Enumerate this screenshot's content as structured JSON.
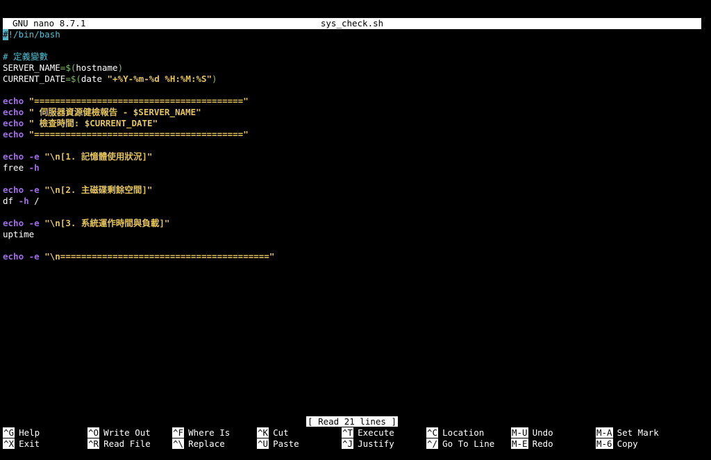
{
  "titlebar": {
    "app_version": "GNU nano 8.7.1",
    "filename": "sys_check.sh"
  },
  "lines": [
    [
      {
        "t": "#",
        "c": "cursor"
      },
      {
        "t": "!/bin/bash",
        "c": "cyan"
      }
    ],
    [],
    [
      {
        "t": "# 定義變數",
        "c": "cyan"
      }
    ],
    [
      {
        "t": "SERVER_NAME",
        "c": "white"
      },
      {
        "t": "=$(",
        "c": "green"
      },
      {
        "t": "hostname",
        "c": "white"
      },
      {
        "t": ")",
        "c": "green"
      }
    ],
    [
      {
        "t": "CURRENT_DATE",
        "c": "white"
      },
      {
        "t": "=$(",
        "c": "green"
      },
      {
        "t": "date ",
        "c": "white"
      },
      {
        "t": "\"+%Y-%m-%d %H:%M:%S\"",
        "c": "yellow"
      },
      {
        "t": ")",
        "c": "green"
      }
    ],
    [],
    [
      {
        "t": "echo ",
        "c": "purple"
      },
      {
        "t": "\"========================================\"",
        "c": "yellow"
      }
    ],
    [
      {
        "t": "echo ",
        "c": "purple"
      },
      {
        "t": "\" 伺服器資源健檢報告 - $SERVER_NAME\"",
        "c": "yellow"
      }
    ],
    [
      {
        "t": "echo ",
        "c": "purple"
      },
      {
        "t": "\" 檢查時間: $CURRENT_DATE\"",
        "c": "yellow"
      }
    ],
    [
      {
        "t": "echo ",
        "c": "purple"
      },
      {
        "t": "\"========================================\"",
        "c": "yellow"
      }
    ],
    [],
    [
      {
        "t": "echo ",
        "c": "purple"
      },
      {
        "t": "-e ",
        "c": "purple"
      },
      {
        "t": "\"\\n[1. 記憶體使用狀況]\"",
        "c": "yellow"
      }
    ],
    [
      {
        "t": "free ",
        "c": "white"
      },
      {
        "t": "-h",
        "c": "purple"
      }
    ],
    [],
    [
      {
        "t": "echo ",
        "c": "purple"
      },
      {
        "t": "-e ",
        "c": "purple"
      },
      {
        "t": "\"\\n[2. 主磁碟剩餘空間]\"",
        "c": "yellow"
      }
    ],
    [
      {
        "t": "df ",
        "c": "white"
      },
      {
        "t": "-h",
        "c": "purple"
      },
      {
        "t": " /",
        "c": "white"
      }
    ],
    [],
    [
      {
        "t": "echo ",
        "c": "purple"
      },
      {
        "t": "-e ",
        "c": "purple"
      },
      {
        "t": "\"\\n[3. 系統運作時間與負載]\"",
        "c": "yellow"
      }
    ],
    [
      {
        "t": "uptime",
        "c": "white"
      }
    ],
    [],
    [
      {
        "t": "echo ",
        "c": "purple"
      },
      {
        "t": "-e ",
        "c": "purple"
      },
      {
        "t": "\"\\n========================================\"",
        "c": "yellow"
      }
    ]
  ],
  "status": {
    "message": "[ Read 21 lines ]"
  },
  "shortcuts": [
    [
      {
        "key": "^G",
        "label": "Help"
      },
      {
        "key": "^X",
        "label": "Exit"
      }
    ],
    [
      {
        "key": "^O",
        "label": "Write Out"
      },
      {
        "key": "^R",
        "label": "Read File"
      }
    ],
    [
      {
        "key": "^F",
        "label": "Where Is"
      },
      {
        "key": "^\\",
        "label": "Replace"
      }
    ],
    [
      {
        "key": "^K",
        "label": "Cut"
      },
      {
        "key": "^U",
        "label": "Paste"
      }
    ],
    [
      {
        "key": "^T",
        "label": "Execute"
      },
      {
        "key": "^J",
        "label": "Justify"
      }
    ],
    [
      {
        "key": "^C",
        "label": "Location"
      },
      {
        "key": "^/",
        "label": "Go To Line"
      }
    ],
    [
      {
        "key": "M-U",
        "label": "Undo"
      },
      {
        "key": "M-E",
        "label": "Redo"
      }
    ],
    [
      {
        "key": "M-A",
        "label": "Set Mark"
      },
      {
        "key": "M-6",
        "label": "Copy"
      }
    ]
  ]
}
